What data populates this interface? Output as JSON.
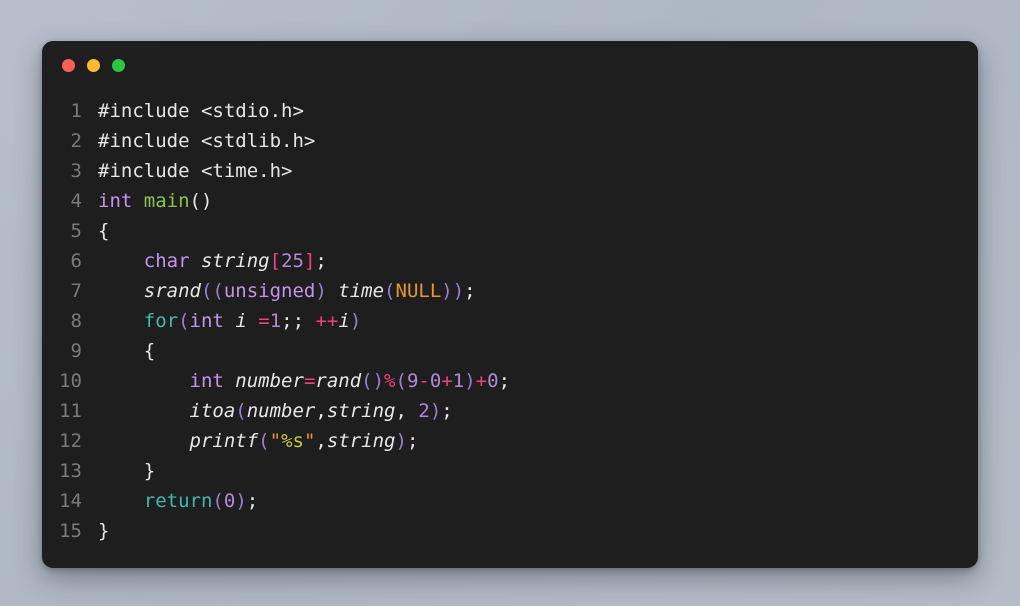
{
  "window": {
    "traffic_lights": [
      {
        "name": "close-button",
        "color": "#ff5f56",
        "label": ""
      },
      {
        "name": "minimize-button",
        "color": "#fdbc2e",
        "label": ""
      },
      {
        "name": "maximize-button",
        "color": "#28c840",
        "label": ""
      }
    ]
  },
  "theme": {
    "page_background": "#b4bcc8",
    "editor_background": "#1e1e1e",
    "gutter_color": "#7a7a7a",
    "default_text": "#e6e6e6",
    "keyword": "#c792ea",
    "control": "#3fb8af",
    "function": "#8bc34a",
    "number": "#b388d9",
    "operator": "#f0407c",
    "punctuation": "#9a7fd0",
    "constant": "#e8962e",
    "string": "#e8962e",
    "string_format": "#ccc93e"
  },
  "editor": {
    "language": "c",
    "line_count": 15,
    "line_numbers": [
      "1",
      "2",
      "3",
      "4",
      "5",
      "6",
      "7",
      "8",
      "9",
      "10",
      "11",
      "12",
      "13",
      "14",
      "15"
    ],
    "lines_plain": [
      "#include <stdio.h>",
      "#include <stdlib.h>",
      "#include <time.h>",
      "int main()",
      "{",
      "    char string[25];",
      "    srand((unsigned) time(NULL));",
      "    for(int i =1;; ++i)",
      "    {",
      "        int number=rand()%(9-0+1)+0;",
      "        itoa(number,string, 2);",
      "        printf(\"%s\",string);",
      "    }",
      "    return(0);",
      "}"
    ],
    "lines": [
      {
        "num": "1",
        "tokens": [
          {
            "t": "#include <stdio.h>",
            "c": "plain"
          }
        ]
      },
      {
        "num": "2",
        "tokens": [
          {
            "t": "#include <stdlib.h>",
            "c": "plain"
          }
        ]
      },
      {
        "num": "3",
        "tokens": [
          {
            "t": "#include <time.h>",
            "c": "plain"
          }
        ]
      },
      {
        "num": "4",
        "tokens": [
          {
            "t": "int",
            "c": "kw"
          },
          {
            "t": " ",
            "c": "plain"
          },
          {
            "t": "main",
            "c": "fn"
          },
          {
            "t": "()",
            "c": "plain"
          }
        ]
      },
      {
        "num": "5",
        "tokens": [
          {
            "t": "{",
            "c": "brace"
          }
        ]
      },
      {
        "num": "6",
        "tokens": [
          {
            "t": "    ",
            "c": "plain"
          },
          {
            "t": "char",
            "c": "kw"
          },
          {
            "t": " ",
            "c": "plain"
          },
          {
            "t": "string",
            "c": "ident"
          },
          {
            "t": "[",
            "c": "op"
          },
          {
            "t": "25",
            "c": "num"
          },
          {
            "t": "]",
            "c": "op"
          },
          {
            "t": ";",
            "c": "semi"
          }
        ]
      },
      {
        "num": "7",
        "tokens": [
          {
            "t": "    ",
            "c": "plain"
          },
          {
            "t": "srand",
            "c": "ident"
          },
          {
            "t": "((",
            "c": "punct"
          },
          {
            "t": "unsigned",
            "c": "kw"
          },
          {
            "t": ")",
            "c": "punct"
          },
          {
            "t": " ",
            "c": "plain"
          },
          {
            "t": "time",
            "c": "ident"
          },
          {
            "t": "(",
            "c": "punct"
          },
          {
            "t": "NULL",
            "c": "const"
          },
          {
            "t": "))",
            "c": "punct"
          },
          {
            "t": ";",
            "c": "semi"
          }
        ]
      },
      {
        "num": "8",
        "tokens": [
          {
            "t": "    ",
            "c": "plain"
          },
          {
            "t": "for",
            "c": "ctrl"
          },
          {
            "t": "(",
            "c": "punct"
          },
          {
            "t": "int",
            "c": "kw"
          },
          {
            "t": " ",
            "c": "plain"
          },
          {
            "t": "i",
            "c": "ident"
          },
          {
            "t": " ",
            "c": "plain"
          },
          {
            "t": "=",
            "c": "op"
          },
          {
            "t": "1",
            "c": "num"
          },
          {
            "t": ";;",
            "c": "semi"
          },
          {
            "t": " ",
            "c": "plain"
          },
          {
            "t": "++",
            "c": "op"
          },
          {
            "t": "i",
            "c": "ident"
          },
          {
            "t": ")",
            "c": "punct"
          }
        ]
      },
      {
        "num": "9",
        "tokens": [
          {
            "t": "    ",
            "c": "plain"
          },
          {
            "t": "{",
            "c": "brace"
          }
        ]
      },
      {
        "num": "10",
        "tokens": [
          {
            "t": "        ",
            "c": "plain"
          },
          {
            "t": "int",
            "c": "kw"
          },
          {
            "t": " ",
            "c": "plain"
          },
          {
            "t": "number",
            "c": "ident"
          },
          {
            "t": "=",
            "c": "op"
          },
          {
            "t": "rand",
            "c": "ident"
          },
          {
            "t": "()",
            "c": "punct"
          },
          {
            "t": "%",
            "c": "op"
          },
          {
            "t": "(",
            "c": "punct"
          },
          {
            "t": "9",
            "c": "num"
          },
          {
            "t": "-",
            "c": "op"
          },
          {
            "t": "0",
            "c": "num"
          },
          {
            "t": "+",
            "c": "op"
          },
          {
            "t": "1",
            "c": "num"
          },
          {
            "t": ")",
            "c": "punct"
          },
          {
            "t": "+",
            "c": "op"
          },
          {
            "t": "0",
            "c": "num"
          },
          {
            "t": ";",
            "c": "semi"
          }
        ]
      },
      {
        "num": "11",
        "tokens": [
          {
            "t": "        ",
            "c": "plain"
          },
          {
            "t": "itoa",
            "c": "ident"
          },
          {
            "t": "(",
            "c": "punct"
          },
          {
            "t": "number",
            "c": "ident"
          },
          {
            "t": ",",
            "c": "plain"
          },
          {
            "t": "string",
            "c": "ident"
          },
          {
            "t": ", ",
            "c": "plain"
          },
          {
            "t": "2",
            "c": "num"
          },
          {
            "t": ")",
            "c": "punct"
          },
          {
            "t": ";",
            "c": "semi"
          }
        ]
      },
      {
        "num": "12",
        "tokens": [
          {
            "t": "        ",
            "c": "plain"
          },
          {
            "t": "printf",
            "c": "ident"
          },
          {
            "t": "(",
            "c": "punct"
          },
          {
            "t": "\"",
            "c": "str"
          },
          {
            "t": "%s",
            "c": "strin"
          },
          {
            "t": "\"",
            "c": "str"
          },
          {
            "t": ",",
            "c": "plain"
          },
          {
            "t": "string",
            "c": "ident"
          },
          {
            "t": ")",
            "c": "punct"
          },
          {
            "t": ";",
            "c": "semi"
          }
        ]
      },
      {
        "num": "13",
        "tokens": [
          {
            "t": "    ",
            "c": "plain"
          },
          {
            "t": "}",
            "c": "brace"
          }
        ]
      },
      {
        "num": "14",
        "tokens": [
          {
            "t": "    ",
            "c": "plain"
          },
          {
            "t": "return",
            "c": "ctrl"
          },
          {
            "t": "(",
            "c": "punct"
          },
          {
            "t": "0",
            "c": "num"
          },
          {
            "t": ")",
            "c": "punct"
          },
          {
            "t": ";",
            "c": "semi"
          }
        ]
      },
      {
        "num": "15",
        "tokens": [
          {
            "t": "}",
            "c": "brace"
          }
        ]
      }
    ]
  }
}
